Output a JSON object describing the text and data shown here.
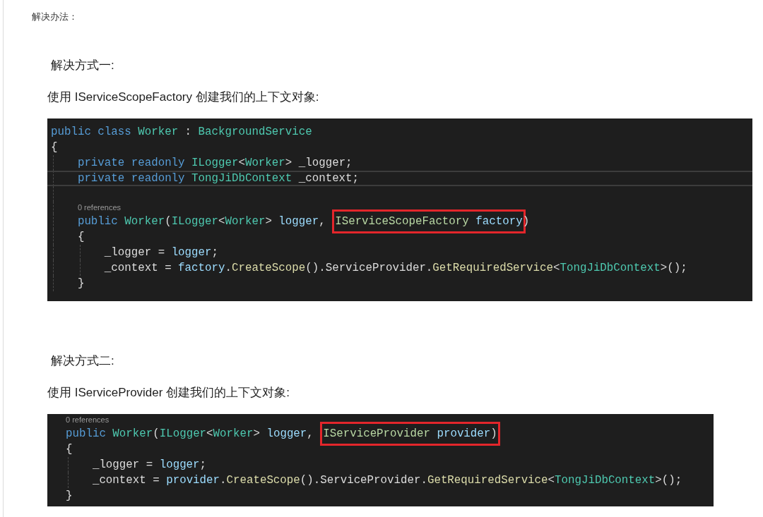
{
  "intro": {
    "text": "解决办法："
  },
  "sections": [
    {
      "heading": "解决方式一:",
      "description": "使用 IServiceScopeFactory 创建我们的上下文对象:",
      "code": {
        "lines": [
          {
            "kind": "code",
            "current": false,
            "segments": [
              {
                "boxed": false,
                "tokens": [
                  {
                    "text": "public class ",
                    "kind": "keyword"
                  },
                  {
                    "text": "Worker",
                    "kind": "type"
                  },
                  {
                    "text": " : ",
                    "kind": "plain"
                  },
                  {
                    "text": "BackgroundService",
                    "kind": "type"
                  }
                ]
              }
            ]
          },
          {
            "kind": "code",
            "current": false,
            "segments": [
              {
                "boxed": false,
                "tokens": [
                  {
                    "text": "{",
                    "kind": "plain"
                  }
                ]
              }
            ],
            "children": [
              {
                "kind": "code",
                "current": false,
                "segments": [
                  {
                    "boxed": false,
                    "tokens": [
                      {
                        "text": "private readonly ",
                        "kind": "keyword"
                      },
                      {
                        "text": "ILogger",
                        "kind": "type"
                      },
                      {
                        "text": "<",
                        "kind": "plain"
                      },
                      {
                        "text": "Worker",
                        "kind": "type"
                      },
                      {
                        "text": "> _logger;",
                        "kind": "plain"
                      }
                    ]
                  }
                ]
              },
              {
                "kind": "code",
                "current": true,
                "segments": [
                  {
                    "boxed": false,
                    "tokens": [
                      {
                        "text": "private readonly ",
                        "kind": "keyword"
                      },
                      {
                        "text": "TongJiDbContext",
                        "kind": "type"
                      },
                      {
                        "text": " _context;",
                        "kind": "plain"
                      }
                    ]
                  }
                ]
              },
              {
                "kind": "blank"
              },
              {
                "kind": "codelens",
                "text": "0 references"
              },
              {
                "kind": "code",
                "current": false,
                "segments": [
                  {
                    "boxed": false,
                    "tokens": [
                      {
                        "text": "public ",
                        "kind": "keyword"
                      },
                      {
                        "text": "Worker",
                        "kind": "type"
                      },
                      {
                        "text": "(",
                        "kind": "plain"
                      },
                      {
                        "text": "ILogger",
                        "kind": "type"
                      },
                      {
                        "text": "<",
                        "kind": "plain"
                      },
                      {
                        "text": "Worker",
                        "kind": "type"
                      },
                      {
                        "text": "> ",
                        "kind": "plain"
                      },
                      {
                        "text": "logger",
                        "kind": "param"
                      },
                      {
                        "text": ",",
                        "kind": "plain"
                      }
                    ]
                  },
                  {
                    "boxed": true,
                    "tokens": [
                      {
                        "text": "IServiceScopeFactory ",
                        "kind": "interface"
                      },
                      {
                        "text": "factory",
                        "kind": "param"
                      }
                    ]
                  },
                  {
                    "boxed": false,
                    "tokens": [
                      {
                        "text": ")",
                        "kind": "plain"
                      }
                    ]
                  }
                ]
              },
              {
                "kind": "code",
                "current": false,
                "segments": [
                  {
                    "boxed": false,
                    "tokens": [
                      {
                        "text": "{",
                        "kind": "plain"
                      }
                    ]
                  }
                ],
                "children": [
                  {
                    "kind": "code",
                    "current": false,
                    "segments": [
                      {
                        "boxed": false,
                        "tokens": [
                          {
                            "text": "_logger = ",
                            "kind": "plain"
                          },
                          {
                            "text": "logger",
                            "kind": "param"
                          },
                          {
                            "text": ";",
                            "kind": "plain"
                          }
                        ]
                      }
                    ]
                  },
                  {
                    "kind": "code",
                    "current": false,
                    "segments": [
                      {
                        "boxed": false,
                        "tokens": [
                          {
                            "text": "_context = ",
                            "kind": "plain"
                          },
                          {
                            "text": "factory",
                            "kind": "param"
                          },
                          {
                            "text": ".",
                            "kind": "plain"
                          },
                          {
                            "text": "CreateScope",
                            "kind": "method"
                          },
                          {
                            "text": "().ServiceProvider.",
                            "kind": "plain"
                          },
                          {
                            "text": "GetRequiredService",
                            "kind": "method"
                          },
                          {
                            "text": "<",
                            "kind": "plain"
                          },
                          {
                            "text": "TongJiDbContext",
                            "kind": "type"
                          },
                          {
                            "text": ">();",
                            "kind": "plain"
                          }
                        ]
                      }
                    ]
                  }
                ]
              },
              {
                "kind": "code",
                "current": false,
                "segments": [
                  {
                    "boxed": false,
                    "tokens": [
                      {
                        "text": "}",
                        "kind": "plain"
                      }
                    ]
                  }
                ]
              }
            ]
          }
        ]
      }
    },
    {
      "heading": "解决方式二:",
      "description": "使用 IServiceProvider 创建我们的上下文对象:",
      "code": {
        "lines": [
          {
            "kind": "codelens",
            "text": "0 references"
          },
          {
            "kind": "code",
            "current": false,
            "segments": [
              {
                "boxed": false,
                "tokens": [
                  {
                    "text": "public ",
                    "kind": "keyword"
                  },
                  {
                    "text": "Worker",
                    "kind": "type"
                  },
                  {
                    "text": "(",
                    "kind": "plain"
                  },
                  {
                    "text": "ILogger",
                    "kind": "type"
                  },
                  {
                    "text": "<",
                    "kind": "plain"
                  },
                  {
                    "text": "Worker",
                    "kind": "type"
                  },
                  {
                    "text": "> ",
                    "kind": "plain"
                  },
                  {
                    "text": "logger",
                    "kind": "param"
                  },
                  {
                    "text": ",",
                    "kind": "plain"
                  }
                ]
              },
              {
                "boxed": true,
                "tokens": [
                  {
                    "text": "IServiceProvider ",
                    "kind": "interface"
                  },
                  {
                    "text": "provider",
                    "kind": "param"
                  },
                  {
                    "text": ")",
                    "kind": "plain"
                  }
                ]
              }
            ]
          },
          {
            "kind": "code",
            "current": false,
            "segments": [
              {
                "boxed": false,
                "tokens": [
                  {
                    "text": "{",
                    "kind": "plain"
                  }
                ]
              }
            ],
            "children": [
              {
                "kind": "code",
                "current": false,
                "segments": [
                  {
                    "boxed": false,
                    "tokens": [
                      {
                        "text": "_logger = ",
                        "kind": "plain"
                      },
                      {
                        "text": "logger",
                        "kind": "param"
                      },
                      {
                        "text": ";",
                        "kind": "plain"
                      }
                    ]
                  }
                ]
              },
              {
                "kind": "code",
                "current": false,
                "segments": [
                  {
                    "boxed": false,
                    "tokens": [
                      {
                        "text": "_context = ",
                        "kind": "plain"
                      },
                      {
                        "text": "provider",
                        "kind": "param"
                      },
                      {
                        "text": ".",
                        "kind": "plain"
                      },
                      {
                        "text": "CreateScope",
                        "kind": "method"
                      },
                      {
                        "text": "().ServiceProvider.",
                        "kind": "plain"
                      },
                      {
                        "text": "GetRequiredService",
                        "kind": "method"
                      },
                      {
                        "text": "<",
                        "kind": "plain"
                      },
                      {
                        "text": "TongJiDbContext",
                        "kind": "type"
                      },
                      {
                        "text": ">();",
                        "kind": "plain"
                      }
                    ]
                  }
                ]
              }
            ]
          },
          {
            "kind": "code",
            "current": false,
            "segments": [
              {
                "boxed": false,
                "tokens": [
                  {
                    "text": "}",
                    "kind": "plain"
                  }
                ]
              }
            ]
          }
        ]
      }
    }
  ]
}
